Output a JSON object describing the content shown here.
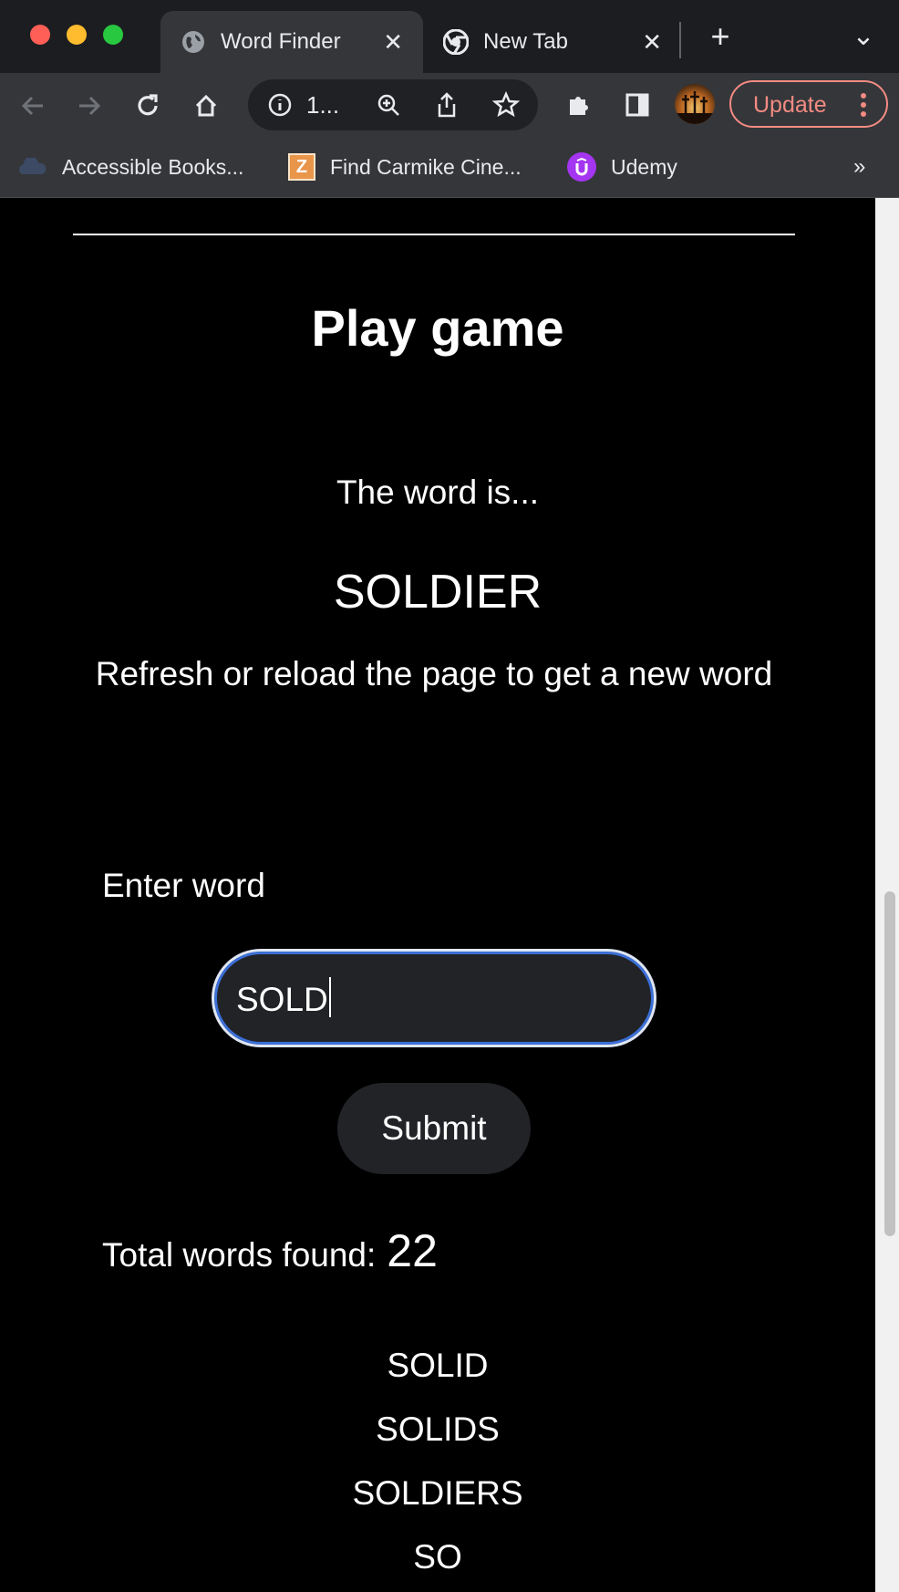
{
  "browser": {
    "tabs": [
      {
        "title": "Word Finder",
        "close": "✕"
      },
      {
        "title": "New Tab",
        "close": "✕"
      }
    ],
    "new_tab": "+",
    "tab_search": "⌄",
    "address": "1...",
    "update_label": "Update",
    "bookmarks": [
      {
        "label": "Accessible Books..."
      },
      {
        "label": "Find Carmike Cine..."
      },
      {
        "label": "Udemy"
      }
    ],
    "bookmarks_overflow": "»"
  },
  "game": {
    "heading": "Play game",
    "word_intro": "The word is...",
    "word": "SOLDIER",
    "hint": "Refresh or reload the page to get a new word",
    "input_label": "Enter word",
    "input_value": "SOLD",
    "submit_label": "Submit",
    "total_label": "Total words found:",
    "total_count": "22",
    "found_words": [
      "SOLID",
      "SOLIDS",
      "SOLDIERS",
      "SO"
    ]
  },
  "colors": {
    "accent": "#3b6fd8",
    "page_bg": "#000000",
    "input_bg": "#212327",
    "button_bg": "#212327",
    "update_border": "#f28b82"
  }
}
